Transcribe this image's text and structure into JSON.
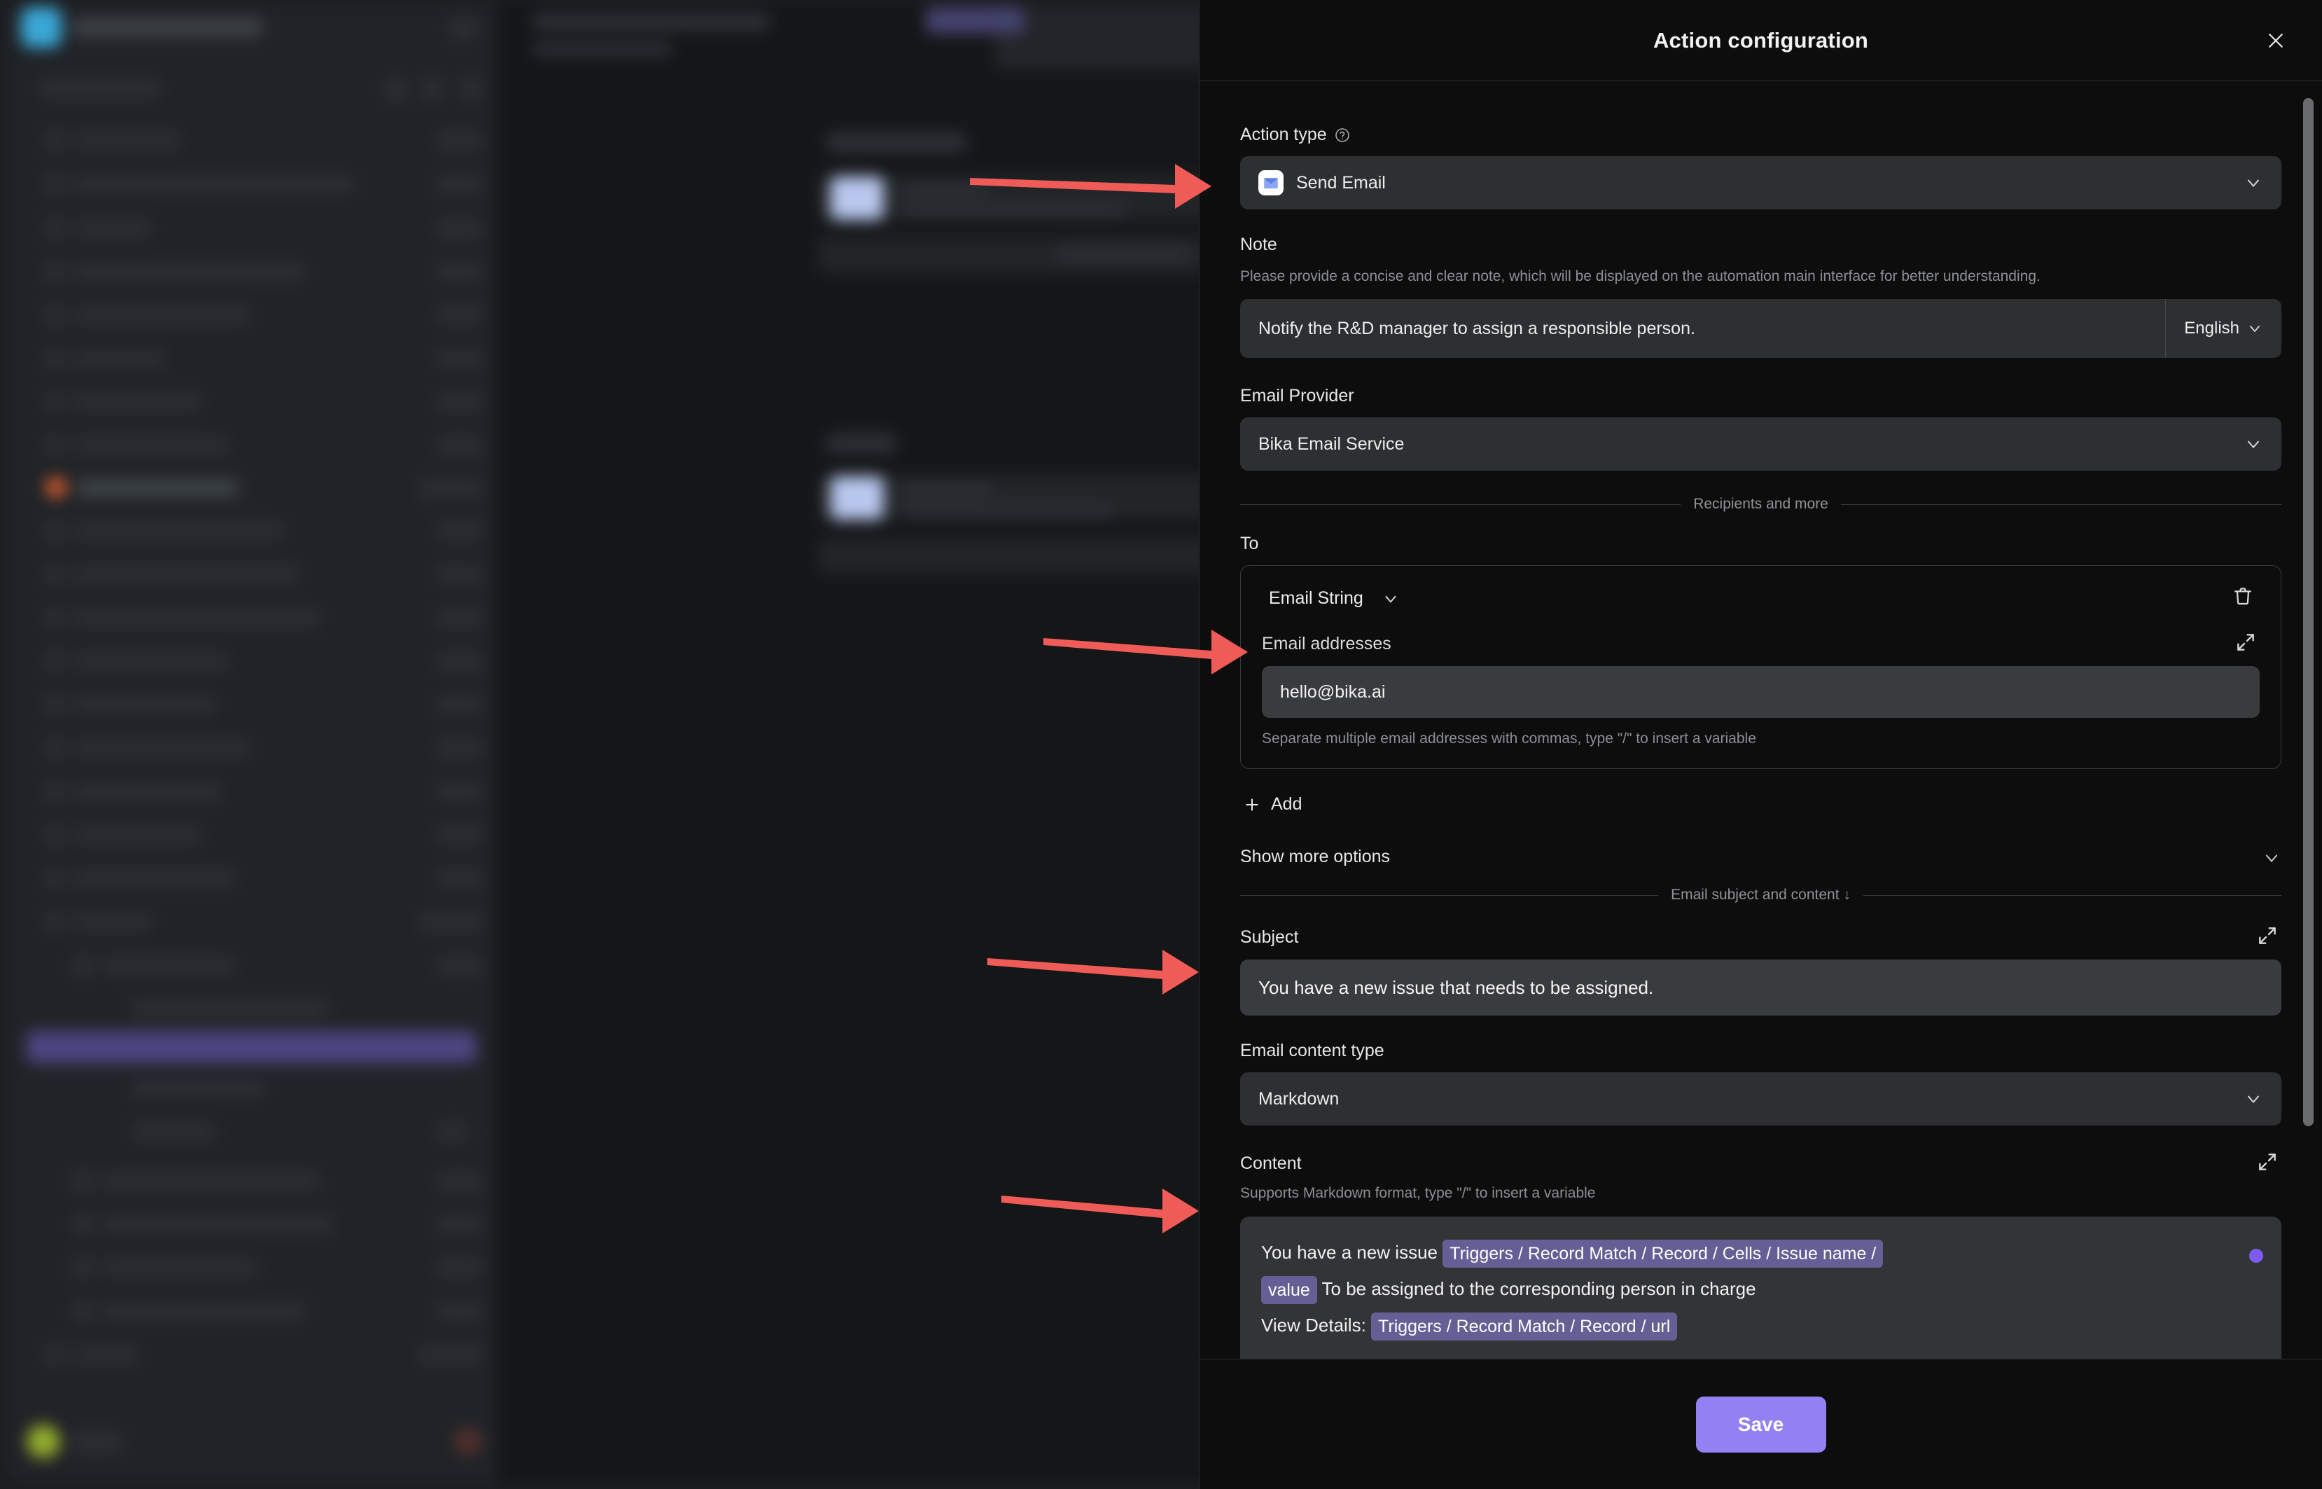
{
  "panel": {
    "title": "Action configuration",
    "close_icon": "close-icon"
  },
  "action_type": {
    "label": "Action type",
    "help_icon": "help-circle-icon",
    "value": "Send Email",
    "icon": "envelope-icon",
    "chevron": "chevron-down-icon"
  },
  "note": {
    "label": "Note",
    "hint": "Please provide a concise and clear note, which will be displayed on the automation main interface for better understanding.",
    "value": "Notify the R&D manager to assign a responsible person.",
    "language": "English",
    "chevron": "chevron-down-icon"
  },
  "email_provider": {
    "label": "Email Provider",
    "value": "Bika Email Service",
    "chevron": "chevron-down-icon"
  },
  "recipients_divider": "Recipients and more",
  "to": {
    "label": "To",
    "type_value": "Email String",
    "type_chevron": "chevron-down-icon",
    "delete_icon": "trash-icon",
    "addresses_label": "Email addresses",
    "expand_icon": "expand-icon",
    "addresses_value": "hello@bika.ai",
    "addresses_hint": "Separate multiple email addresses with commas, type \"/\" to insert a variable"
  },
  "add_button": {
    "label": "Add",
    "icon": "plus-icon"
  },
  "show_more": {
    "label": "Show more options",
    "chevron": "chevron-down-icon"
  },
  "content_divider": "Email subject and content ↓",
  "subject": {
    "label": "Subject",
    "expand_icon": "expand-icon",
    "value": "You have a new issue that needs to be assigned."
  },
  "email_content_type": {
    "label": "Email content type",
    "value": "Markdown",
    "chevron": "chevron-down-icon"
  },
  "content": {
    "label": "Content",
    "expand_icon": "expand-icon",
    "hint": "Supports Markdown format, type \"/\" to insert a variable",
    "line1_prefix": "You have a new issue ",
    "line1_tag": "Triggers / Record Match / Record / Cells / Issue name /",
    "line2_tag": "value",
    "line2_text": " To be assigned to the corresponding person in charge",
    "line3_prefix": "View Details: ",
    "line3_tag": "Triggers / Record Match / Record / url"
  },
  "footer": {
    "save_label": "Save"
  },
  "colors": {
    "accent": "#9381f3",
    "variable_tag": "#655f96",
    "annotation_arrow": "#ef5b57",
    "panel_bg": "#0d0d0e",
    "input_bg": "#3a3b3d"
  }
}
